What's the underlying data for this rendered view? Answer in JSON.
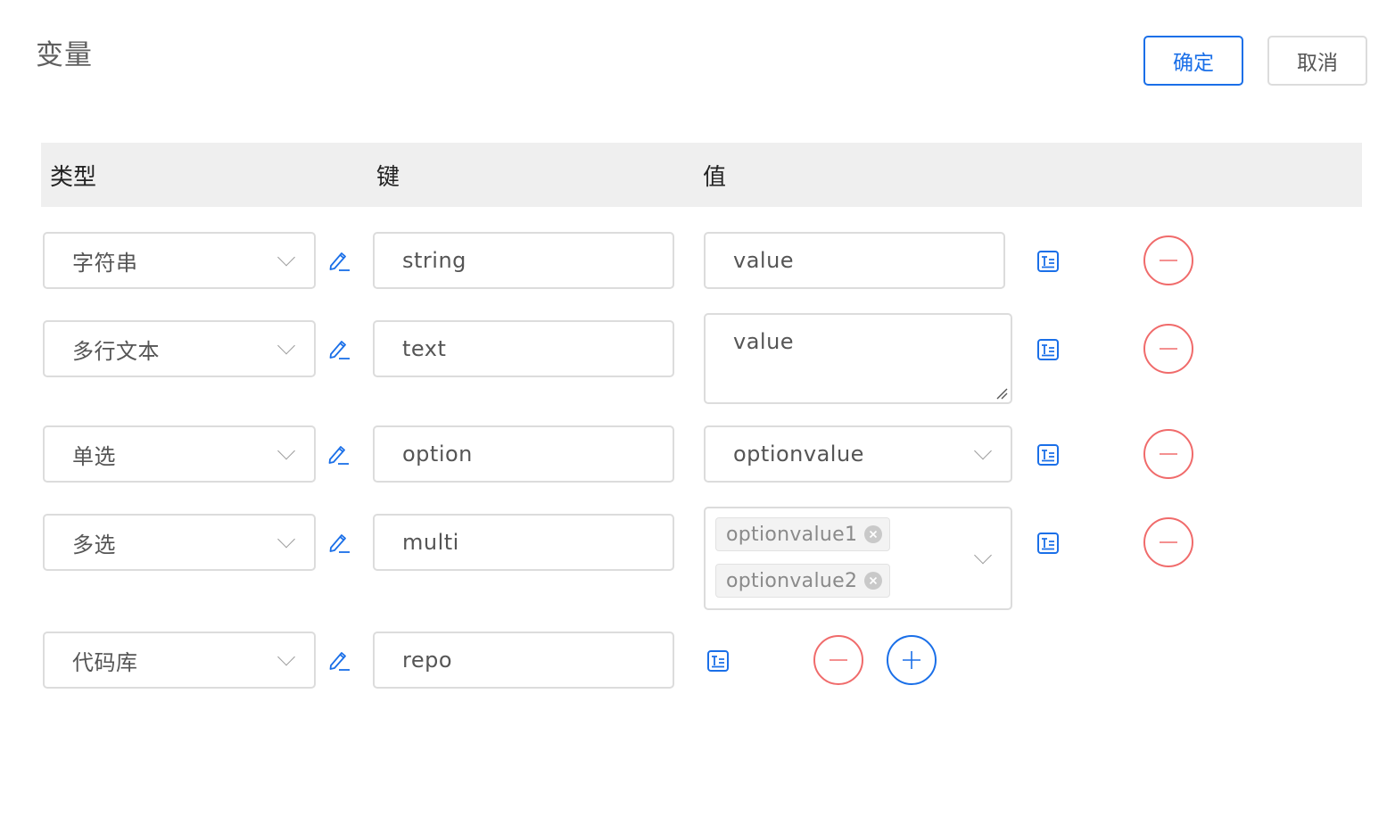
{
  "page": {
    "title": "变量"
  },
  "actions": {
    "confirm_label": "确定",
    "cancel_label": "取消"
  },
  "table": {
    "headers": {
      "type": "类型",
      "key": "键",
      "value": "值"
    },
    "rows": [
      {
        "type": "字符串",
        "key": "string",
        "value": "value"
      },
      {
        "type": "多行文本",
        "key": "text",
        "value": "value"
      },
      {
        "type": "单选",
        "key": "option",
        "value": "optionvalue"
      },
      {
        "type": "多选",
        "key": "multi",
        "value_tags": [
          "optionvalue1",
          "optionvalue2"
        ]
      },
      {
        "type": "代码库",
        "key": "repo"
      }
    ]
  },
  "icons": {
    "edit": "edit-pencil-icon",
    "value_mode": "text-format-icon",
    "remove": "minus-circle-icon",
    "add": "plus-circle-icon",
    "dropdown": "chevron-down-icon",
    "tag_close": "close-icon"
  },
  "colors": {
    "accent": "#1a6fe8",
    "danger": "#f06b6b",
    "header_bg": "#efefef",
    "border": "#dcdcdc"
  }
}
